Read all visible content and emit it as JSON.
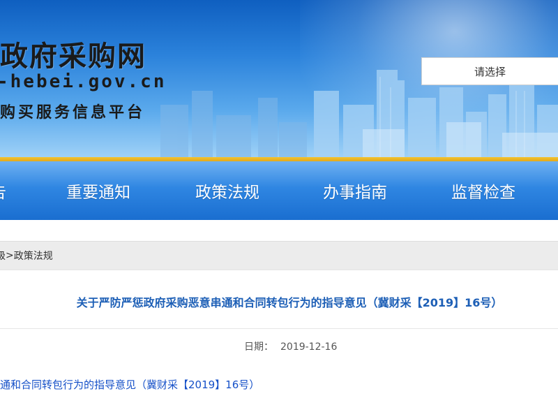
{
  "header": {
    "logo_title": "政府采购网",
    "logo_domain": "-hebei.gov.cn",
    "logo_subtitle": "购买服务信息平台",
    "select_label": "请选择"
  },
  "nav": {
    "items": [
      {
        "label": "告"
      },
      {
        "label": "重要通知"
      },
      {
        "label": "政策法规"
      },
      {
        "label": "办事指南"
      },
      {
        "label": "监督检查"
      }
    ]
  },
  "breadcrumb": {
    "parent": "级",
    "separator": ">",
    "current": "政策法规"
  },
  "article": {
    "title": "关于严防严惩政府采购恶意串通和合同转包行为的指导意见（冀财采【2019】16号）",
    "date_label": "日期：",
    "date_value": "2019-12-16",
    "attachment_link": "通和合同转包行为的指导意见（冀财采【2019】16号）"
  },
  "colors": {
    "nav_blue": "#2f86e2",
    "gold_stripe": "#e3a91a",
    "title_blue": "#1d5fb6",
    "link_blue": "#1550c8"
  }
}
